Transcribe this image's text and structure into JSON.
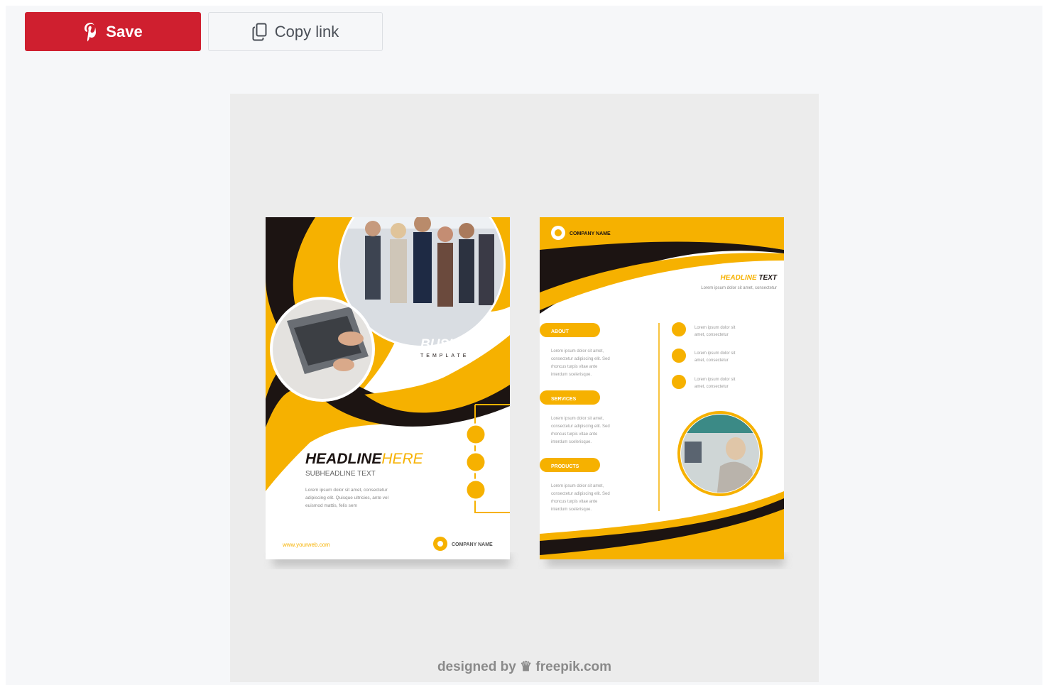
{
  "toolbar": {
    "save_label": "Save",
    "copy_link_label": "Copy link",
    "save_color": "#cf1f2f",
    "icons": {
      "save": "pinterest-icon",
      "copy": "copy-icon"
    }
  },
  "image": {
    "front": {
      "business_title": "BUSINESS",
      "business_sub": "TEMPLATE",
      "headline_main": "HEADLINE",
      "headline_accent": "HERE",
      "subheadline": "SUBHEADLINE TEXT",
      "body_lines": [
        "Lorem ipsum dolor sit amet, consectetur",
        "adipiscing elit. Quisque ultricies, ante vel",
        "euismod mattis, felis sem"
      ],
      "website": "www.yourweb.com",
      "company": "COMPANY NAME"
    },
    "back": {
      "company": "COMPANY NAME",
      "headline_main": "HEADLINE",
      "headline_accent": "TEXT",
      "headline_sub": "Lorem ipsum dolor sit amet, consectetur",
      "sections": [
        {
          "label": "ABOUT",
          "lines": [
            "Lorem ipsum dolor sit amet,",
            "consectetur adipiscing elit. Sed",
            "rhoncus turpis vitae ante",
            "interdum scelerisque."
          ]
        },
        {
          "label": "SERVICES",
          "lines": [
            "Lorem ipsum dolor sit amet,",
            "consectetur adipiscing elit. Sed",
            "rhoncus turpis vitae ante",
            "interdum scelerisque."
          ]
        },
        {
          "label": "PRODUCTS",
          "lines": [
            "Lorem ipsum dolor sit amet,",
            "consectetur adipiscing elit. Sed",
            "rhoncus turpis vitae ante",
            "interdum scelerisque."
          ]
        }
      ],
      "bullets": [
        {
          "line1": "Lorem ipsum dolor sit",
          "line2": "amet, consectetur"
        },
        {
          "line1": "Lorem ipsum dolor sit",
          "line2": "amet, consectetur"
        },
        {
          "line1": "Lorem ipsum dolor sit",
          "line2": "amet, consectetur"
        }
      ]
    },
    "credit_prefix": "designed by",
    "credit_brand": "freepik.com",
    "colors": {
      "accent": "#f6b100",
      "dark": "#1c1412",
      "frame": "#ececec"
    }
  }
}
